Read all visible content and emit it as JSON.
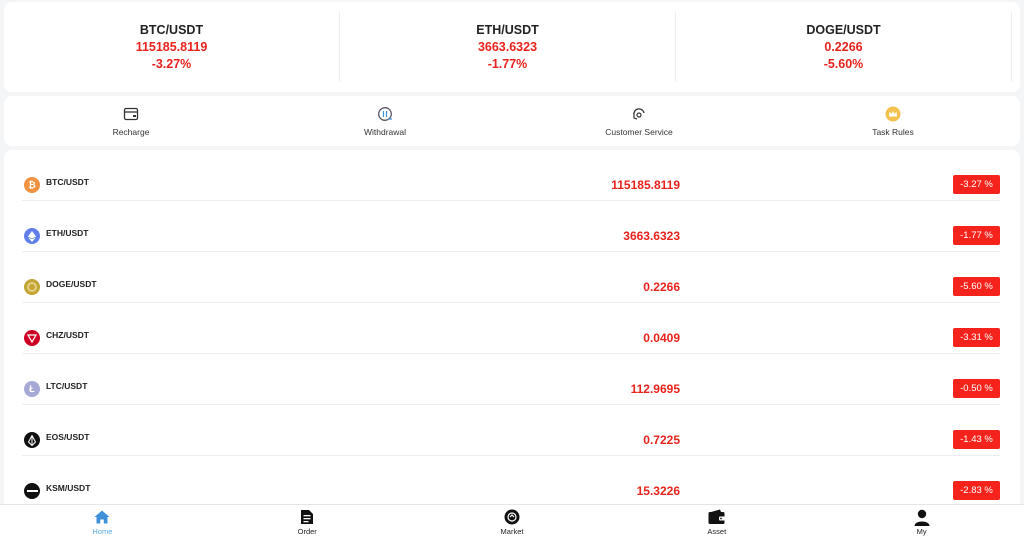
{
  "tickers": [
    {
      "pair": "BTC/USDT",
      "price": "115185.8119",
      "change": "-3.27%"
    },
    {
      "pair": "ETH/USDT",
      "price": "3663.6323",
      "change": "-1.77%"
    },
    {
      "pair": "DOGE/USDT",
      "price": "0.2266",
      "change": "-5.60%"
    }
  ],
  "actions": [
    {
      "label": "Recharge",
      "icon": "wallet-card-icon"
    },
    {
      "label": "Withdrawal",
      "icon": "coin-withdraw-icon"
    },
    {
      "label": "Customer Service",
      "icon": "headset-icon"
    },
    {
      "label": "Task Rules",
      "icon": "crown-icon"
    }
  ],
  "markets": [
    {
      "symbol": "BTC/USDT",
      "price": "115185.8119",
      "change": "-3.27 %",
      "icon": "bitcoin-icon",
      "color": "#f09242"
    },
    {
      "symbol": "ETH/USDT",
      "price": "3663.6323",
      "change": "-1.77 %",
      "icon": "ethereum-icon",
      "color": "#627eea"
    },
    {
      "symbol": "DOGE/USDT",
      "price": "0.2266",
      "change": "-5.60 %",
      "icon": "dogecoin-icon",
      "color": "#c2a633"
    },
    {
      "symbol": "CHZ/USDT",
      "price": "0.0409",
      "change": "-3.31 %",
      "icon": "chiliz-icon",
      "color": "#cd0124"
    },
    {
      "symbol": "LTC/USDT",
      "price": "112.9695",
      "change": "-0.50 %",
      "icon": "litecoin-icon",
      "color": "#a6a9d6"
    },
    {
      "symbol": "EOS/USDT",
      "price": "0.7225",
      "change": "-1.43 %",
      "icon": "eos-icon",
      "color": "#111111"
    },
    {
      "symbol": "KSM/USDT",
      "price": "15.3226",
      "change": "-2.83 %",
      "icon": "kusama-icon",
      "color": "#111111"
    }
  ],
  "nav": [
    {
      "label": "Home",
      "icon": "home-icon",
      "active": true
    },
    {
      "label": "Order",
      "icon": "order-document-icon",
      "active": false
    },
    {
      "label": "Market",
      "icon": "market-icon",
      "active": false
    },
    {
      "label": "Asset",
      "icon": "wallet-icon",
      "active": false
    },
    {
      "label": "My",
      "icon": "user-icon",
      "active": false
    }
  ],
  "colors": {
    "down": "#e8221c",
    "badge": "#f5231b",
    "nav_active": "#5ea7de"
  }
}
